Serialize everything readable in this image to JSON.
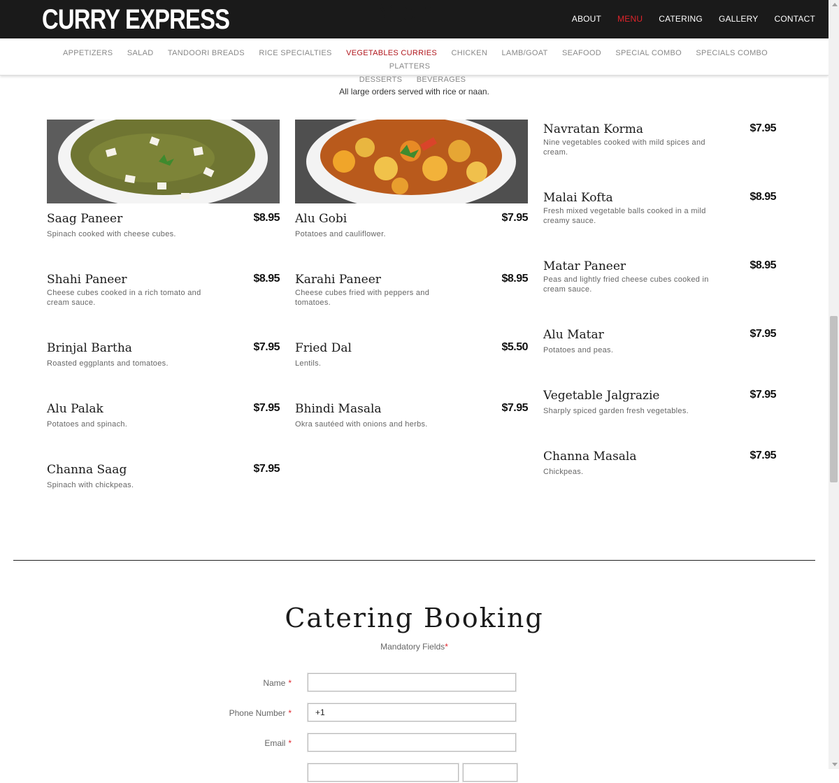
{
  "header": {
    "logo": "CURRY EXPRESS",
    "page_heading": "Menu",
    "nav": [
      {
        "label": "ABOUT",
        "active": false
      },
      {
        "label": "MENU",
        "active": true
      },
      {
        "label": "CATERING",
        "active": false
      },
      {
        "label": "GALLERY",
        "active": false
      },
      {
        "label": "CONTACT",
        "active": false
      }
    ]
  },
  "categories": [
    {
      "label": "APPETIZERS",
      "active": false
    },
    {
      "label": "SALAD",
      "active": false
    },
    {
      "label": "TANDOORI BREADS",
      "active": false
    },
    {
      "label": "RICE SPECIALTIES",
      "active": false
    },
    {
      "label": "VEGETABLES CURRIES",
      "active": true
    },
    {
      "label": "CHICKEN",
      "active": false
    },
    {
      "label": "LAMB/GOAT",
      "active": false
    },
    {
      "label": "SEAFOOD",
      "active": false
    },
    {
      "label": "SPECIAL COMBO",
      "active": false
    },
    {
      "label": "SPECIALS COMBO PLATTERS",
      "active": false
    },
    {
      "label": "DESSERTS",
      "active": false
    },
    {
      "label": "BEVERAGES",
      "active": false
    }
  ],
  "note": "All large orders served with rice or naan.",
  "menu": {
    "col1": [
      {
        "name": "Saag Paneer",
        "price": "$8.95",
        "desc": "Spinach cooked with cheese cubes.",
        "photo": "saag-paneer-photo"
      },
      {
        "name": "Shahi Paneer",
        "price": "$8.95",
        "desc": "Cheese cubes cooked in a rich tomato and cream sauce."
      },
      {
        "name": "Brinjal Bartha",
        "price": "$7.95",
        "desc": "Roasted eggplants and tomatoes."
      },
      {
        "name": "Alu Palak",
        "price": "$7.95",
        "desc": "Potatoes and spinach."
      },
      {
        "name": "Channa Saag",
        "price": "$7.95",
        "desc": "Spinach with chickpeas."
      }
    ],
    "col2": [
      {
        "name": "Alu Gobi",
        "price": "$7.95",
        "desc": "Potatoes and cauliflower.",
        "photo": "alu-gobi-photo"
      },
      {
        "name": "Karahi Paneer",
        "price": "$8.95",
        "desc": "Cheese cubes fried with peppers and tomatoes."
      },
      {
        "name": "Fried Dal",
        "price": "$5.50",
        "desc": "Lentils."
      },
      {
        "name": "Bhindi Masala",
        "price": "$7.95",
        "desc": "Okra sautéed with onions and herbs."
      }
    ],
    "col3": [
      {
        "name": "Navratan Korma",
        "price": "$7.95",
        "desc": "Nine vegetables cooked with mild spices and cream."
      },
      {
        "name": "Malai Kofta",
        "price": "$8.95",
        "desc": "Fresh mixed vegetable balls cooked in a mild creamy sauce."
      },
      {
        "name": "Matar Paneer",
        "price": "$8.95",
        "desc": "Peas and lightly fried cheese cubes cooked in cream sauce."
      },
      {
        "name": "Alu Matar",
        "price": "$7.95",
        "desc": "Potatoes and peas."
      },
      {
        "name": "Vegetable Jalgrazie",
        "price": "$7.95",
        "desc": "Sharply spiced garden fresh vegetables."
      },
      {
        "name": "Channa Masala",
        "price": "$7.95",
        "desc": "Chickpeas."
      }
    ]
  },
  "booking": {
    "title": "Catering Booking",
    "mandatory": "Mandatory Fields",
    "mandatory_mark": "*",
    "required_mark": "*",
    "fields": {
      "name": {
        "label": "Name",
        "value": ""
      },
      "phone": {
        "label": "Phone Number",
        "value": "+1"
      },
      "email": {
        "label": "Email",
        "value": ""
      }
    }
  },
  "colors": {
    "accent": "#e0242b",
    "active_category": "#b0161c",
    "header_bg": "#1a1a1a"
  }
}
